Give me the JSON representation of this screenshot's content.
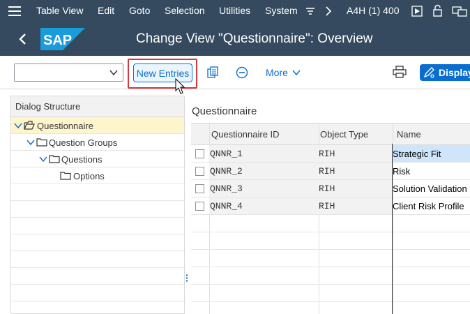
{
  "menubar": {
    "items": [
      {
        "label": "Table View"
      },
      {
        "label": "Edit"
      },
      {
        "label": "Goto"
      },
      {
        "label": "Selection"
      },
      {
        "label": "Utilities"
      },
      {
        "label": "System"
      }
    ],
    "system_id": "A4H (1) 400"
  },
  "titlebar": {
    "logo_text": "SAP",
    "title": "Change View \"Questionnaire\": Overview"
  },
  "toolbar": {
    "combo_value": "",
    "new_entries_label": "New Entries",
    "more_label": "More",
    "display_label": "Display"
  },
  "dialog_structure": {
    "header": "Dialog Structure",
    "items": [
      {
        "label": "Questionnaire",
        "level": 0,
        "selected": true
      },
      {
        "label": "Question Groups",
        "level": 1
      },
      {
        "label": "Questions",
        "level": 2
      },
      {
        "label": "Options",
        "level": 3
      }
    ]
  },
  "grid": {
    "title": "Questionnaire",
    "columns": [
      "Questionnaire ID",
      "Object Type",
      "Name"
    ],
    "rows": [
      {
        "id": "QNNR_1",
        "type": "RIH",
        "name": "Strategic Fit"
      },
      {
        "id": "QNNR_2",
        "type": "RIH",
        "name": "Risk"
      },
      {
        "id": "QNNR_3",
        "type": "RIH",
        "name": "Solution Validation"
      },
      {
        "id": "QNNR_4",
        "type": "RIH",
        "name": "Client Risk Profile"
      }
    ]
  },
  "colors": {
    "shell": "#354a5f",
    "accent": "#0a6ed1",
    "highlight": "#d0393e",
    "tree_selected": "#fff5cc",
    "cell_selected": "#cfe5fb"
  }
}
